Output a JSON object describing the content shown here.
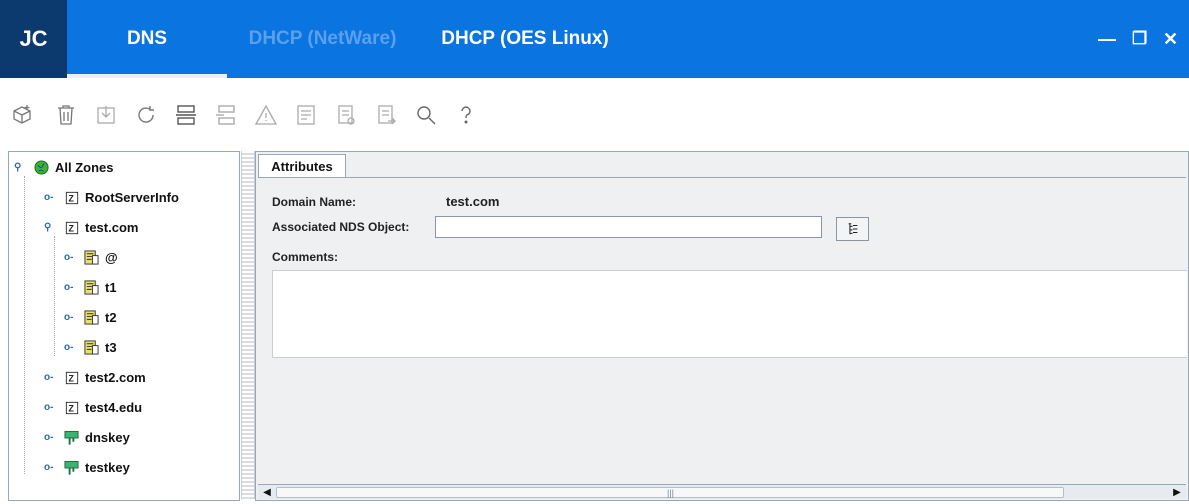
{
  "app": {
    "logo": "JC"
  },
  "tabs": [
    {
      "label": "DNS",
      "active": true
    },
    {
      "label": "DHCP (NetWare)",
      "active": false
    },
    {
      "label": "DHCP (OES Linux)",
      "active": false
    }
  ],
  "window_controls": {
    "minimize": "—",
    "restore": "❐",
    "close": "✕"
  },
  "toolbar": {
    "icons": [
      "new-object-icon",
      "delete-icon",
      "import-icon",
      "refresh-icon",
      "start-service-icon",
      "stop-service-icon",
      "warning-icon",
      "view-events-icon",
      "audit-trail-icon",
      "export-icon",
      "search-icon",
      "help-icon"
    ]
  },
  "tree": {
    "root": "All Zones",
    "items": [
      {
        "label": "RootServerInfo",
        "type": "zone"
      },
      {
        "label": "test.com",
        "type": "zone"
      },
      {
        "label": "@",
        "type": "rr"
      },
      {
        "label": "t1",
        "type": "rr"
      },
      {
        "label": "t2",
        "type": "rr"
      },
      {
        "label": "t3",
        "type": "rr"
      },
      {
        "label": "test2.com",
        "type": "zone"
      },
      {
        "label": "test4.edu",
        "type": "zone"
      },
      {
        "label": "dnskey",
        "type": "key"
      },
      {
        "label": "testkey",
        "type": "key"
      }
    ]
  },
  "attributes": {
    "tab_label": "Attributes",
    "domain_name_label": "Domain Name:",
    "domain_name_value": "test.com",
    "nds_object_label": "Associated NDS Object:",
    "nds_object_value": "",
    "comments_label": "Comments:",
    "comments_value": "",
    "scroll_thumb_grip": "|||"
  },
  "colors": {
    "title_bar": "#0a74e0",
    "logo_bg": "#0d3a6e",
    "inactive_tab": "#5aa0ec"
  }
}
